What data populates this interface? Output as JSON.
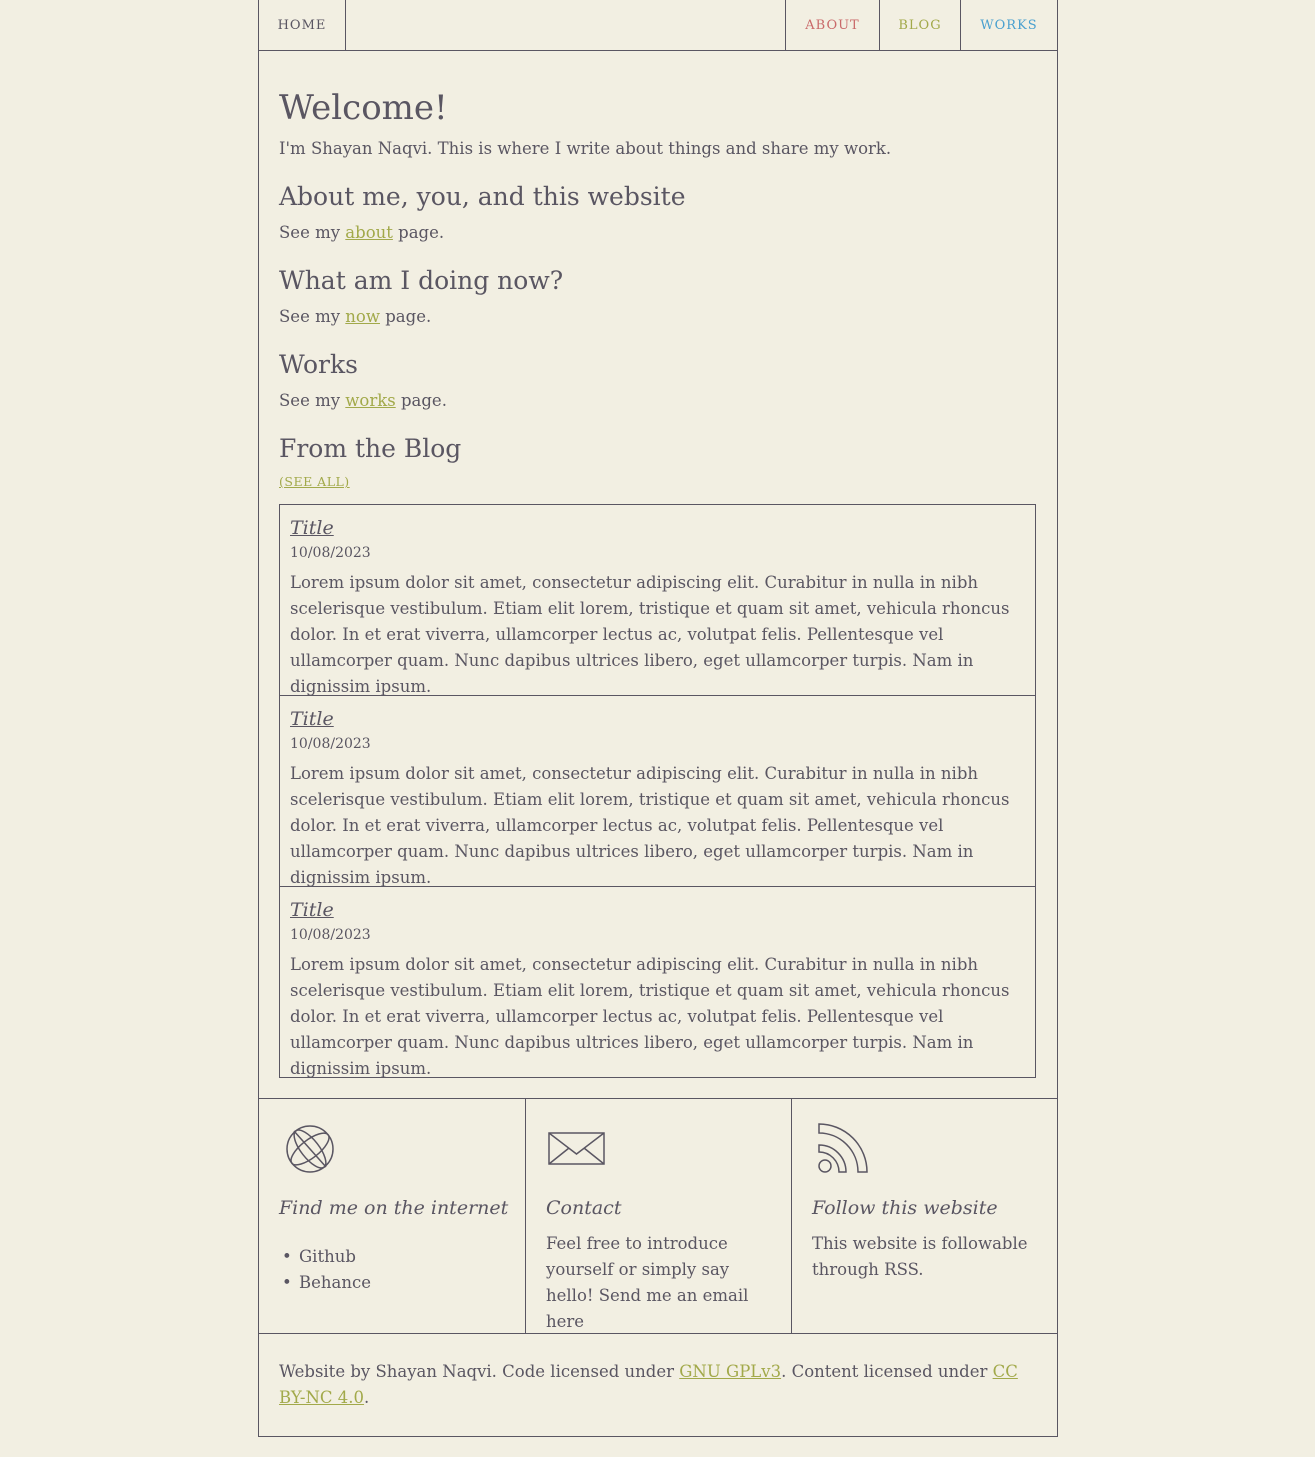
{
  "nav": {
    "home": "HOME",
    "about": "ABOUT",
    "blog": "BLOG",
    "works": "WORKS"
  },
  "main": {
    "title": "Welcome!",
    "intro": "I'm Shayan Naqvi. This is where I write about things and share my work.",
    "sections": [
      {
        "heading": "About me, you, and this website",
        "prefix": "See my ",
        "link": "about",
        "suffix": " page."
      },
      {
        "heading": "What am I doing now?",
        "prefix": "See my ",
        "link": "now",
        "suffix": " page."
      },
      {
        "heading": "Works",
        "prefix": "See my ",
        "link": "works",
        "suffix": " page."
      }
    ],
    "blog_heading": "From the Blog",
    "see_all": "(SEE ALL)",
    "posts": [
      {
        "title": "Title",
        "date": "10/08/2023",
        "body": "Lorem ipsum dolor sit amet, consectetur adipiscing elit. Curabitur in nulla in nibh scelerisque vestibulum. Etiam elit lorem, tristique et quam sit amet, vehicula rhoncus dolor. In et erat viverra, ullamcorper lectus ac, volutpat felis. Pellentesque vel ullamcorper quam. Nunc dapibus ultrices libero, eget ullamcorper turpis. Nam in dignissim ipsum."
      },
      {
        "title": "Title",
        "date": "10/08/2023",
        "body": "Lorem ipsum dolor sit amet, consectetur adipiscing elit. Curabitur in nulla in nibh scelerisque vestibulum. Etiam elit lorem, tristique et quam sit amet, vehicula rhoncus dolor. In et erat viverra, ullamcorper lectus ac, volutpat felis. Pellentesque vel ullamcorper quam. Nunc dapibus ultrices libero, eget ullamcorper turpis. Nam in dignissim ipsum."
      },
      {
        "title": "Title",
        "date": "10/08/2023",
        "body": "Lorem ipsum dolor sit amet, consectetur adipiscing elit. Curabitur in nulla in nibh scelerisque vestibulum. Etiam elit lorem, tristique et quam sit amet, vehicula rhoncus dolor. In et erat viverra, ullamcorper lectus ac, volutpat felis. Pellentesque vel ullamcorper quam. Nunc dapibus ultrices libero, eget ullamcorper turpis. Nam in dignissim ipsum."
      }
    ]
  },
  "footer": {
    "internet": {
      "icon": "globe-icon",
      "heading": "Find me on the internet",
      "links": [
        "Github",
        "Behance"
      ]
    },
    "contact": {
      "icon": "envelope-icon",
      "heading": "Contact",
      "text": "Feel free to introduce yourself or simply say hello! Send me an email here"
    },
    "follow": {
      "icon": "rss-icon",
      "heading": "Follow this website",
      "text": "This website is followable through RSS."
    },
    "credit": {
      "part1": "Website by Shayan Naqvi. Code licensed under ",
      "code_license": "GNU GPLv3",
      "part2": ". Content licensed under ",
      "content_license": "CC BY-NC 4.0",
      "part3": "."
    }
  },
  "colors": {
    "background": "#f2efe2",
    "text": "#5a5662",
    "about": "#c96a6a",
    "blog": "#a2a94a",
    "works": "#4aa0cf"
  }
}
